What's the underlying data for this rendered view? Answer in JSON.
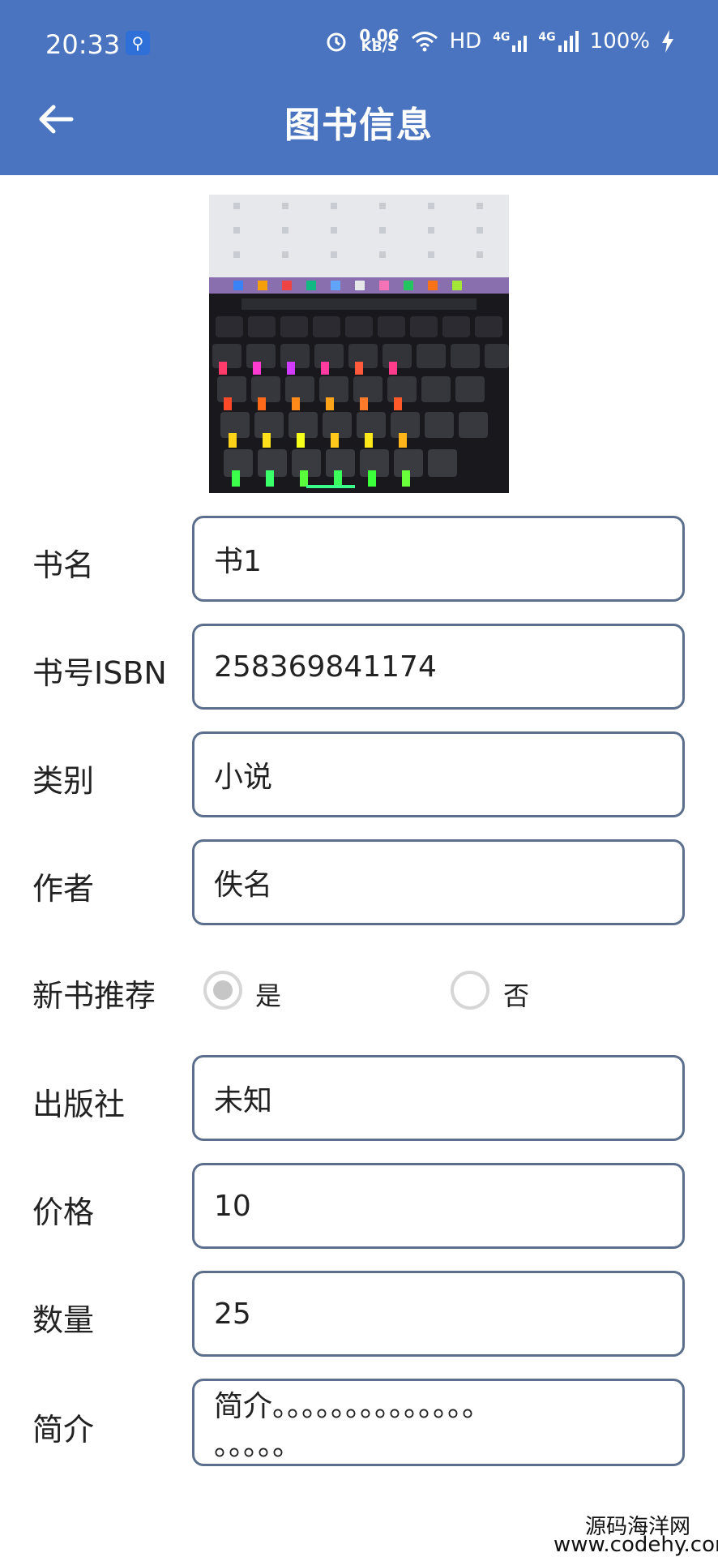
{
  "status_bar": {
    "time": "20:33",
    "net_speed_value": "0.06",
    "net_speed_unit": "KB/S",
    "hd": "HD",
    "net1": "4G",
    "net2": "4G",
    "battery": "100%"
  },
  "header": {
    "title": "图书信息",
    "back_icon": "arrow-left-icon"
  },
  "form": {
    "name_label": "书名",
    "name_value": "书1",
    "isbn_label": "书号ISBN",
    "isbn_value": "258369841174",
    "category_label": "类别",
    "category_value": "小说",
    "author_label": "作者",
    "author_value": "佚名",
    "recommend_label": "新书推荐",
    "recommend_yes": "是",
    "recommend_no": "否",
    "recommend_selected": "是",
    "publisher_label": "出版社",
    "publisher_value": "未知",
    "price_label": "价格",
    "price_value": "10",
    "quantity_label": "数量",
    "quantity_value": "25",
    "intro_label": "简介",
    "intro_value_line1": "简介。。。。。。。。。。。。。。",
    "intro_value_line2": "。。。。。"
  },
  "watermark": {
    "line1": "源码海洋网",
    "line2": "www.codehy.com"
  },
  "colors": {
    "header_bg": "#4a74bf",
    "field_border": "#5b6f8c"
  }
}
